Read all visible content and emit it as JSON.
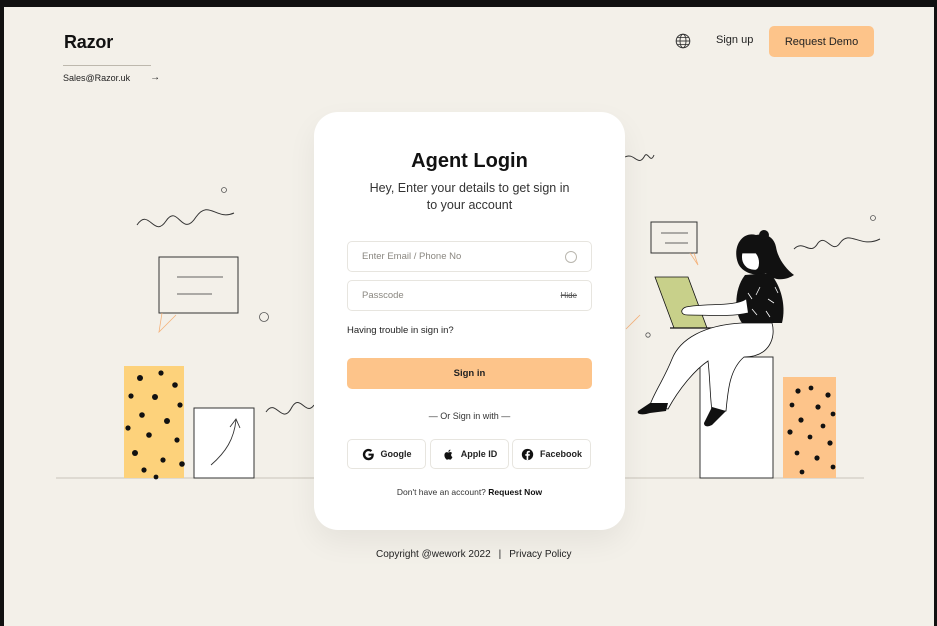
{
  "brand": {
    "name": "Razor",
    "email": "Sales@Razor.uk",
    "email_arrow": "→"
  },
  "header": {
    "signup_label": "Sign up",
    "demo_label": "Request Demo"
  },
  "login": {
    "title": "Agent Login",
    "subtitle": "Hey, Enter your details to get sign in to your account",
    "email_placeholder": "Enter Email / Phone No",
    "passcode_placeholder": "Passcode",
    "hide_label": "Hide",
    "trouble_label": "Having trouble in sign in?",
    "signin_label": "Sign in",
    "or_label": "— Or Sign in with —",
    "social": [
      {
        "label": "Google",
        "icon": "google-icon"
      },
      {
        "label": "Apple ID",
        "icon": "apple-icon"
      },
      {
        "label": "Facebook",
        "icon": "facebook-icon"
      }
    ],
    "no_account_text": "Don't have an account?",
    "request_now_label": "Request Now"
  },
  "footer": {
    "copyright": "Copyright @wework 2022",
    "separator": "|",
    "privacy_label": "Privacy Policy"
  },
  "colors": {
    "accent": "#fdc48a",
    "background": "#f3f0e9",
    "card": "#ffffff",
    "laptop": "#c8d08a"
  }
}
